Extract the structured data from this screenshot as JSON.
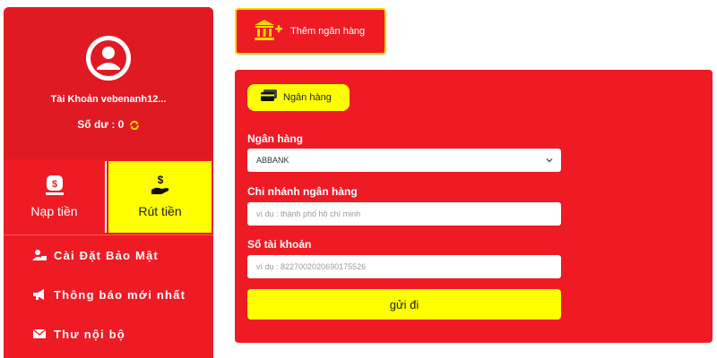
{
  "sidebar": {
    "account_name": "Tài Khoản vebenanh12...",
    "balance_label": "Số dư :",
    "balance_value": "0",
    "deposit_label": "Nạp tiền",
    "withdraw_label": "Rút tiền",
    "menu": [
      {
        "label": "Cài Đặt Bảo Mật",
        "icon": "user-lock-icon"
      },
      {
        "label": "Thông báo mới nhất",
        "icon": "megaphone-icon"
      },
      {
        "label": "Thư nội bộ",
        "icon": "envelope-icon"
      }
    ]
  },
  "top_tab": {
    "label": "Thêm ngân hàng",
    "icon": "bank-plus-icon"
  },
  "form": {
    "subtab_label": "Ngân hàng",
    "bank_label": "Ngân hàng",
    "bank_value": "ABBANK",
    "branch_label": "Chi nhánh ngân hàng",
    "branch_placeholder": "ví dụ : thành phố hồ chí minh",
    "account_label": "Số tài khoản",
    "account_placeholder": "ví dụ : 8227002020690175526",
    "submit_label": "gửi đi"
  },
  "colors": {
    "primary_red": "#ee1b24",
    "accent_yellow": "#ffff00",
    "border_gold": "#ffd400"
  }
}
